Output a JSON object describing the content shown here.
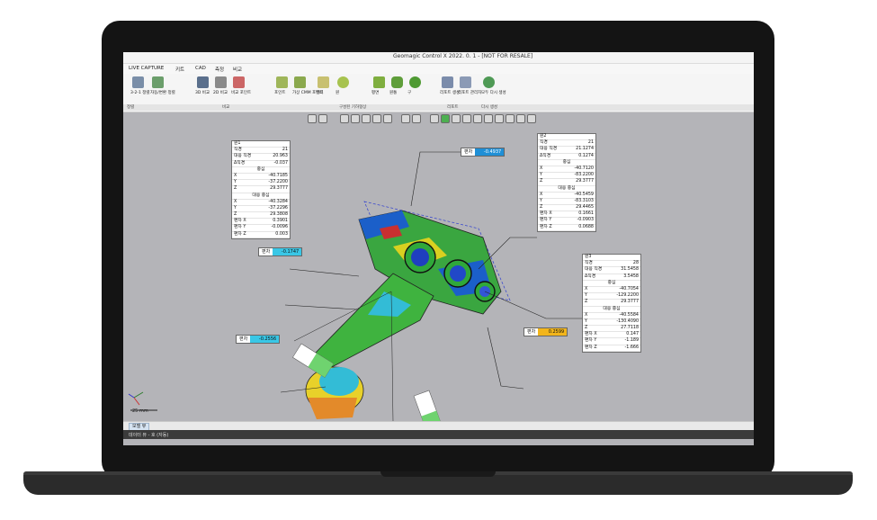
{
  "window": {
    "title": "Geomagic Control X 2022. 0. 1 - [NOT FOR RESALE]"
  },
  "menu": [
    "LIVE CAPTURE",
    "키트",
    "CAD",
    "측정",
    "비교"
  ],
  "ribbon": {
    "buttons": [
      {
        "label": "3-2-1 정렬",
        "icon": "align-icon"
      },
      {
        "label": "자동/변환 정렬",
        "icon": "transform-icon"
      },
      {
        "label": "3D 비교",
        "icon": "compare-3d-icon"
      },
      {
        "label": "2D 비교",
        "icon": "compare-2d-icon"
      },
      {
        "label": "비교 포인트",
        "icon": "compare-point-icon"
      },
      {
        "label": "포인트",
        "icon": "point-icon"
      },
      {
        "label": "가상 CMM 포인트",
        "icon": "cmm-point-icon"
      },
      {
        "label": "벡터",
        "icon": "vector-icon"
      },
      {
        "label": "원",
        "icon": "circle-icon"
      },
      {
        "label": "평면",
        "icon": "plane-icon"
      },
      {
        "label": "원통",
        "icon": "cylinder-icon"
      },
      {
        "label": "구",
        "icon": "sphere-icon"
      },
      {
        "label": "리포트 생성",
        "icon": "report-icon"
      },
      {
        "label": "리포트 관리자",
        "icon": "report-manager-icon"
      },
      {
        "label": "모두 다시 생성",
        "icon": "regenerate-icon"
      }
    ],
    "groups": [
      "정렬",
      "비교",
      "구성된 기하형상",
      "리포트",
      "다시 생성"
    ]
  },
  "callouts": {
    "circle1": {
      "title": "원1",
      "rows": [
        [
          "직경",
          "21"
        ],
        [
          "대응 직경",
          "20.963"
        ],
        [
          "Δ직경",
          "-0.037"
        ],
        [
          "중심",
          ""
        ],
        [
          "X",
          "-40.7185"
        ],
        [
          "Y",
          "-37.2200"
        ],
        [
          "Z",
          "29.3777"
        ],
        [
          "대응 중심",
          ""
        ],
        [
          "X",
          "-40.3284"
        ],
        [
          "Y",
          "-37.2296"
        ],
        [
          "Z",
          "29.3808"
        ],
        [
          "편차 X",
          "0.3901"
        ],
        [
          "편차 Y",
          "-0.0096"
        ],
        [
          "편차 Z",
          "0.003"
        ]
      ]
    },
    "circle2": {
      "title": "원2",
      "rows": [
        [
          "직경",
          "21"
        ],
        [
          "대응 직경",
          "21.1274"
        ],
        [
          "Δ직경",
          "0.1274"
        ],
        [
          "중심",
          ""
        ],
        [
          "X",
          "-40.7120"
        ],
        [
          "Y",
          "-83.2200"
        ],
        [
          "Z",
          "29.3777"
        ],
        [
          "대응 중심",
          ""
        ],
        [
          "X",
          "-40.5459"
        ],
        [
          "Y",
          "-83.3103"
        ],
        [
          "Z",
          "29.4465"
        ],
        [
          "편차 X",
          "0.1661"
        ],
        [
          "편차 Y",
          "-0.0903"
        ],
        [
          "편차 Z",
          "0.0688"
        ]
      ]
    },
    "circle3": {
      "title": "원3",
      "rows": [
        [
          "직경",
          "28"
        ],
        [
          "대응 직경",
          "31.5458"
        ],
        [
          "Δ직경",
          "3.5458"
        ],
        [
          "중심",
          ""
        ],
        [
          "X",
          "-40.7054"
        ],
        [
          "Y",
          "-129.2200"
        ],
        [
          "Z",
          "29.3777"
        ],
        [
          "대응 중심",
          ""
        ],
        [
          "X",
          "-40.5584"
        ],
        [
          "Y",
          "-130.4090"
        ],
        [
          "Z",
          "27.7118"
        ],
        [
          "편차 X",
          "0.147"
        ],
        [
          "편차 Y",
          "-1.189"
        ],
        [
          "편차 Z",
          "-1.666"
        ]
      ]
    }
  },
  "deviations": [
    {
      "key": "편차",
      "value": "-0.4937",
      "color": "#1f8fd6"
    },
    {
      "key": "편차",
      "value": "-0.1747",
      "color": "#39c7e6"
    },
    {
      "key": "편차",
      "value": "-0.2556",
      "color": "#39c7e6"
    },
    {
      "key": "편차",
      "value": "0.2599",
      "color": "#f2b51b"
    }
  ],
  "footer": {
    "tab": "모델 뷰",
    "status": "데이터 뷰 - 호 (자동)",
    "scale": "25 mm"
  }
}
